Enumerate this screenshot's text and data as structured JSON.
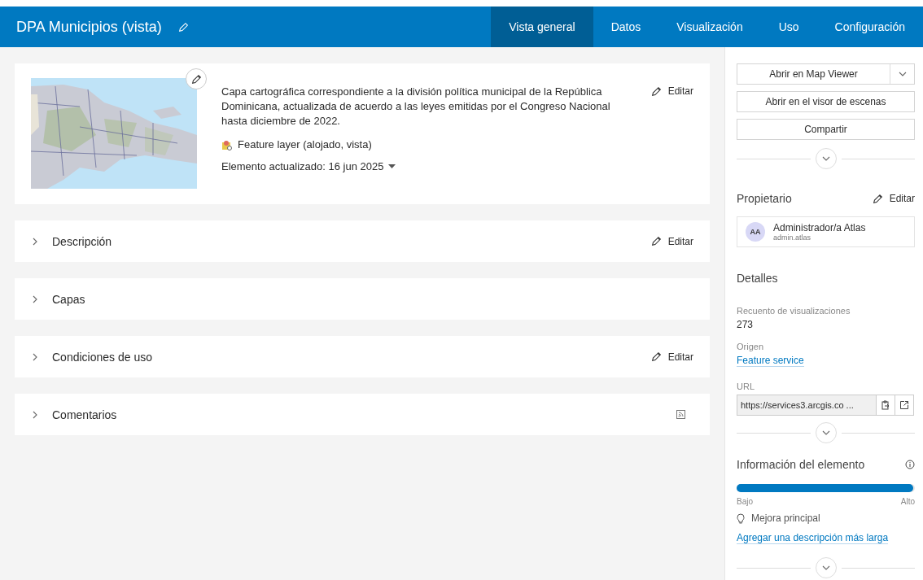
{
  "header": {
    "title": "DPA Municipios (vista)",
    "tabs": [
      {
        "label": "Vista general",
        "selected": true
      },
      {
        "label": "Datos",
        "selected": false
      },
      {
        "label": "Visualización",
        "selected": false
      },
      {
        "label": "Uso",
        "selected": false
      },
      {
        "label": "Configuración",
        "selected": false
      }
    ]
  },
  "summary": {
    "description": "Capa cartográfica correspondiente a la división política municipal de la República Dominicana, actualizada de acuerdo a las leyes emitidas por el Congreso Nacional hasta diciembre de 2022.",
    "type": "Feature layer (alojado, vista)",
    "updated": "Elemento actualizado: 16 jun 2025",
    "edit": "Editar"
  },
  "sections": [
    {
      "title": "Descripción",
      "kind": "edit",
      "action": "Editar"
    },
    {
      "title": "Capas",
      "kind": "none"
    },
    {
      "title": "Condiciones de uso",
      "kind": "edit",
      "action": "Editar"
    },
    {
      "title": "Comentarios",
      "kind": "rss"
    }
  ],
  "sidebar": {
    "buttons": [
      {
        "label": "Abrir en Map Viewer",
        "dropdown": true
      },
      {
        "label": "Abrir en el visor de escenas",
        "dropdown": false
      },
      {
        "label": "Compartir",
        "dropdown": false
      }
    ],
    "owner": {
      "heading": "Propietario",
      "edit": "Editar",
      "initials": "AA",
      "name": "Administrador/a Atlas",
      "username": "admin.atlas"
    },
    "details": {
      "heading": "Detalles",
      "fields": [
        {
          "label": "Recuento de visualizaciones",
          "value": "273",
          "kind": "text"
        },
        {
          "label": "Origen",
          "value": "Feature service",
          "kind": "link"
        }
      ],
      "url": {
        "label": "URL",
        "value": "https://services3.arcgis.co ..."
      }
    },
    "info": {
      "heading": "Información del elemento",
      "level": 0.99,
      "low": "Bajo",
      "high": "Alto",
      "tip": "Mejora principal",
      "link": "Agregar una descripción más larga"
    }
  }
}
